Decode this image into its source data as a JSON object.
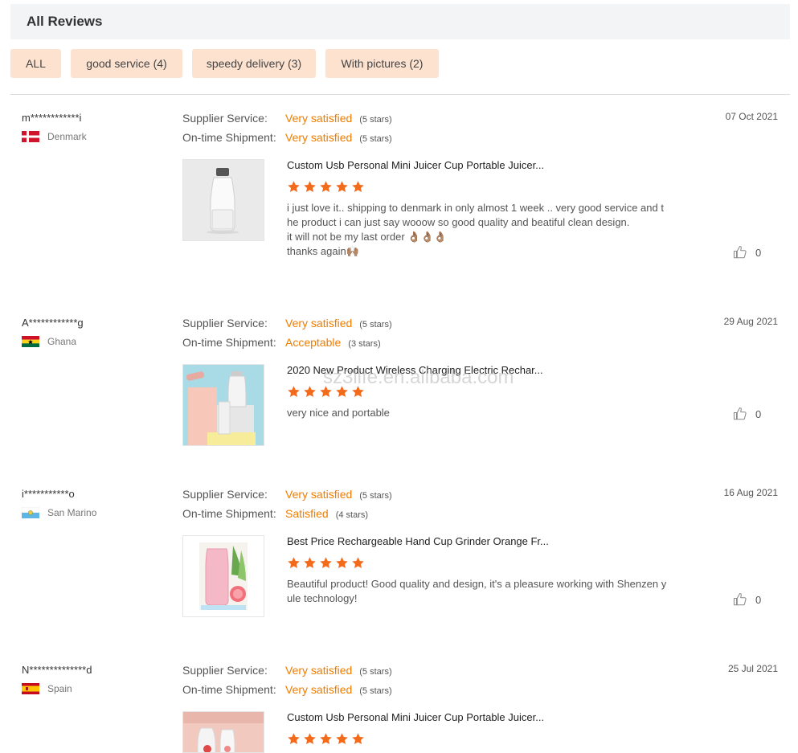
{
  "header": {
    "title": "All Reviews"
  },
  "filters": [
    {
      "label": "ALL"
    },
    {
      "label": "good service (4)"
    },
    {
      "label": "speedy delivery (3)"
    },
    {
      "label": "With pictures (2)"
    }
  ],
  "labels": {
    "supplier": "Supplier Service:",
    "shipment": "On-time Shipment:"
  },
  "watermark": "sz3life.en.alibaba.com",
  "colors": {
    "accent": "#f07d00",
    "star": "#f26b1d",
    "filter_bg": "#fde2d0"
  },
  "reviews": [
    {
      "user": "m************i",
      "country": "Denmark",
      "date": "07 Oct 2021",
      "supplier": {
        "value": "Very satisfied",
        "stars": "(5 stars)"
      },
      "shipment": {
        "value": "Very satisfied",
        "stars": "(5 stars)"
      },
      "product": "Custom Usb Personal Mini Juicer Cup Portable Juicer...",
      "rating": 5,
      "comment": "i just love it.. shipping to denmark in only almost 1 week .. very good service and t\nhe product i can just say wooow so good quality and beatiful clean design.\nit will not be my last order 👌🏽👌🏽👌🏽\nthanks again🙌🏽",
      "likes": "0"
    },
    {
      "user": "A************g",
      "country": "Ghana",
      "date": "29 Aug 2021",
      "supplier": {
        "value": "Very satisfied",
        "stars": "(5 stars)"
      },
      "shipment": {
        "value": "Acceptable",
        "stars": "(3 stars)"
      },
      "product": "2020 New Product Wireless Charging Electric Rechar...",
      "rating": 5,
      "comment": "very nice and portable",
      "likes": "0"
    },
    {
      "user": "i***********o",
      "country": "San Marino",
      "date": "16 Aug 2021",
      "supplier": {
        "value": "Very satisfied",
        "stars": "(5 stars)"
      },
      "shipment": {
        "value": "Satisfied",
        "stars": "(4 stars)"
      },
      "product": "Best Price Rechargeable Hand Cup Grinder Orange Fr...",
      "rating": 5,
      "comment": "Beautiful product! Good quality and design, it's a pleasure working with Shenzen y\nule technology!",
      "likes": "0"
    },
    {
      "user": "N**************d",
      "country": "Spain",
      "date": "25 Jul 2021",
      "supplier": {
        "value": "Very satisfied",
        "stars": "(5 stars)"
      },
      "shipment": {
        "value": "Very satisfied",
        "stars": "(5 stars)"
      },
      "product": "Custom Usb Personal Mini Juicer Cup Portable Juicer...",
      "rating": 5,
      "comment": "",
      "likes": ""
    }
  ]
}
